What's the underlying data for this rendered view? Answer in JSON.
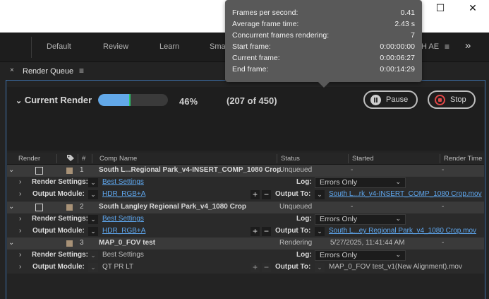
{
  "window": {
    "maximize_glyph": "☐",
    "close_glyph": "✕"
  },
  "workspace": {
    "items": [
      "Default",
      "Review",
      "Learn",
      "Sma",
      "H AE"
    ],
    "menu_glyph": "≡",
    "more_glyph": "»"
  },
  "panel": {
    "title": "Render Queue",
    "close_glyph": "×",
    "menu_glyph": "≡"
  },
  "current_render": {
    "label": "Current Render",
    "percent": 46,
    "percent_text": "46%",
    "frames_text": "(207 of 450)",
    "pause_label": "Pause",
    "stop_label": "Stop"
  },
  "tooltip": {
    "rows": [
      {
        "key": "Frames per second:",
        "value": "0.41"
      },
      {
        "key": "Average frame time:",
        "value": "2.43 s"
      },
      {
        "key": "Concurrent frames rendering:",
        "value": "7"
      },
      {
        "key": "Start frame:",
        "value": "0:00:00:00"
      },
      {
        "key": "Current frame:",
        "value": "0:00:06:27"
      },
      {
        "key": "End frame:",
        "value": "0:00:14:29"
      }
    ]
  },
  "columns": {
    "render": "Render",
    "tag_icon": "tag-icon",
    "num": "#",
    "comp": "Comp Name",
    "status": "Status",
    "started": "Started",
    "render_time": "Render Time"
  },
  "labels": {
    "render_settings": "Render Settings:",
    "output_module": "Output Module:",
    "log": "Log:",
    "output_to": "Output To:"
  },
  "items": [
    {
      "num": "1",
      "comp": "South L...Regional Park_v4-INSERT_COMP_1080 Crop",
      "status": "Unqueued",
      "started": "-",
      "render_time": "-",
      "render_settings": "Best Settings",
      "log": "Errors Only",
      "output_module": "HDR_RGB+A",
      "output_to": "South L...rk_v4-INSERT_COMP_1080 Crop.mov"
    },
    {
      "num": "2",
      "comp": "South Langley Regional Park_v4_1080 Crop",
      "status": "Unqueued",
      "started": "-",
      "render_time": "-",
      "render_settings": "Best Settings",
      "log": "Errors Only",
      "output_module": "HDR_RGB+A",
      "output_to": "South L...ey Regional Park_v4_1080 Crop.mov"
    },
    {
      "num": "3",
      "comp": "MAP_0_FOV test",
      "status": "Rendering",
      "started": "5/27/2025, 11:41:44 AM",
      "render_time": "-",
      "render_settings": "Best Settings",
      "log": "Errors Only",
      "output_module": "QT PR LT",
      "output_to": "MAP_0_FOV test_v1(New Alignment).mov"
    }
  ]
}
